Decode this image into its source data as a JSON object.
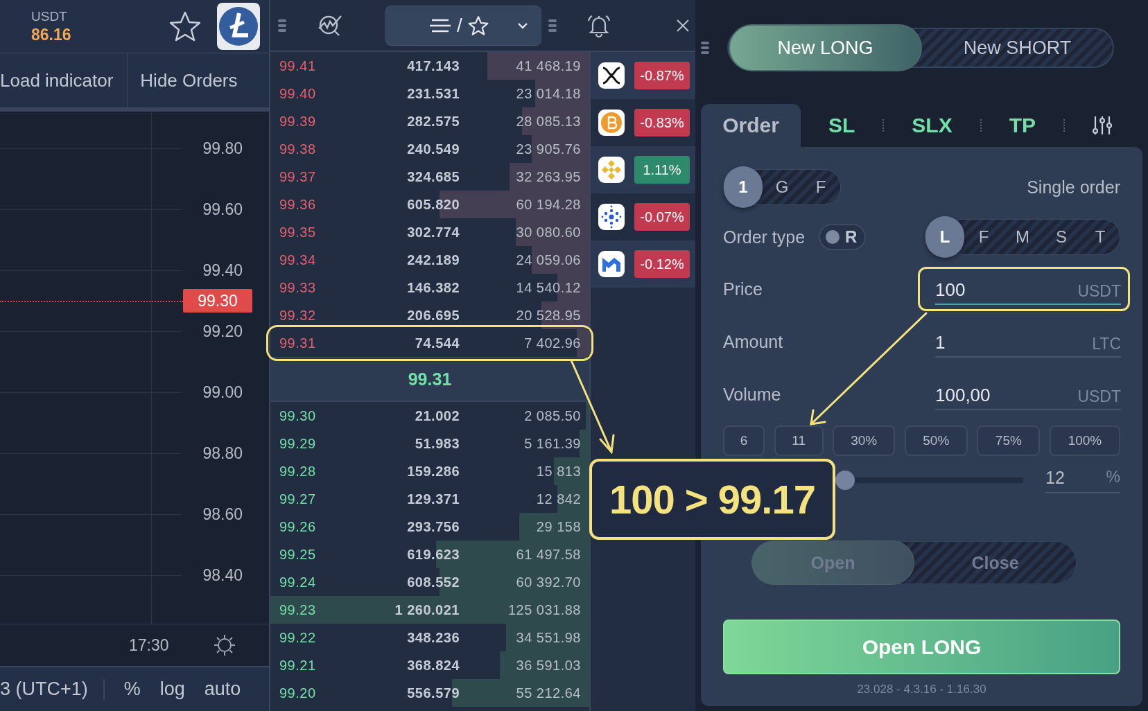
{
  "header": {
    "quote_label": "USDT",
    "price": "86.16"
  },
  "chart_toolbar": {
    "buttons": [
      "Load indicator",
      "Hide Orders"
    ]
  },
  "chart": {
    "price_axis": [
      "99.80",
      "99.60",
      "99.40",
      "99.20",
      "99.00",
      "98.80",
      "98.60",
      "98.40"
    ],
    "last_price": "99.30",
    "time_label": "17:30"
  },
  "chart_footer": {
    "timezone": "3 (UTC+1)",
    "options": [
      "%",
      "log",
      "auto"
    ]
  },
  "book_toolbar": {
    "filter_separator": "/"
  },
  "order_book": {
    "asks": [
      {
        "price": "99.41",
        "amount": "417.143",
        "total": "41 468.19",
        "level": 0.32,
        "highlighted": false
      },
      {
        "price": "99.40",
        "amount": "231.531",
        "total": "23 014.18",
        "level": 0.17,
        "highlighted": false
      },
      {
        "price": "99.39",
        "amount": "282.575",
        "total": "28 085.13",
        "level": 0.21,
        "highlighted": false
      },
      {
        "price": "99.38",
        "amount": "240.549",
        "total": "23 905.76",
        "level": 0.18,
        "highlighted": false
      },
      {
        "price": "99.37",
        "amount": "324.685",
        "total": "32 263.95",
        "level": 0.25,
        "highlighted": false
      },
      {
        "price": "99.36",
        "amount": "605.820",
        "total": "60 194.28",
        "level": 0.47,
        "highlighted": false
      },
      {
        "price": "99.35",
        "amount": "302.774",
        "total": "30 080.60",
        "level": 0.23,
        "highlighted": false
      },
      {
        "price": "99.34",
        "amount": "242.189",
        "total": "24 059.06",
        "level": 0.18,
        "highlighted": false
      },
      {
        "price": "99.33",
        "amount": "146.382",
        "total": "14 540.12",
        "level": 0.1,
        "highlighted": false
      },
      {
        "price": "99.32",
        "amount": "206.695",
        "total": "20 528.95",
        "level": 0.15,
        "highlighted": false
      },
      {
        "price": "99.31",
        "amount": "74.544",
        "total": "7 402.96",
        "level": 0.04,
        "highlighted": true
      }
    ],
    "mid_price": "99.31",
    "bids": [
      {
        "price": "99.30",
        "amount": "21.002",
        "total": "2 085.50",
        "level": 0.01
      },
      {
        "price": "99.29",
        "amount": "51.983",
        "total": "5 161.39",
        "level": 0.03
      },
      {
        "price": "99.28",
        "amount": "159.286",
        "total": "15 813",
        "level": 0.11
      },
      {
        "price": "99.27",
        "amount": "129.371",
        "total": "12 842",
        "level": 0.1
      },
      {
        "price": "99.26",
        "amount": "293.756",
        "total": "29 158",
        "level": 0.22
      },
      {
        "price": "99.25",
        "amount": "619.623",
        "total": "61 497.58",
        "level": 0.48
      },
      {
        "price": "99.24",
        "amount": "608.552",
        "total": "60 392.70",
        "level": 0.47
      },
      {
        "price": "99.23",
        "amount": "1 260.021",
        "total": "125 031.88",
        "level": 1
      },
      {
        "price": "99.22",
        "amount": "348.236",
        "total": "34 551.98",
        "level": 0.26
      },
      {
        "price": "99.21",
        "amount": "368.824",
        "total": "36 591.03",
        "level": 0.28
      },
      {
        "price": "99.20",
        "amount": "556.579",
        "total": "55 212.64",
        "level": 0.43
      }
    ]
  },
  "watchlist": [
    {
      "change": "-0.87%",
      "color": "#c23a50"
    },
    {
      "change": "-0.83%",
      "color": "#c23a50"
    },
    {
      "change": "1.11%",
      "color": "#2f8a6c"
    },
    {
      "change": "-0.07%",
      "color": "#c23a50"
    },
    {
      "change": "-0.12%",
      "color": "#c23a50"
    }
  ],
  "trade_panel": {
    "sides": [
      {
        "label": "New LONG",
        "selected": true
      },
      {
        "label": "New SHORT",
        "selected": false
      }
    ],
    "tabs": [
      {
        "label": "Order",
        "selected": true
      },
      {
        "label": "SL",
        "selected": false
      },
      {
        "label": "SLX",
        "selected": false
      },
      {
        "label": "TP",
        "selected": false
      }
    ],
    "modes": [
      {
        "label": "1",
        "selected": true
      },
      {
        "label": "G",
        "selected": false
      },
      {
        "label": "F",
        "selected": false
      }
    ],
    "mode_label": "Single order",
    "order_type": {
      "label": "Order type",
      "toggle_label": "R",
      "on": false,
      "options": [
        {
          "label": "L",
          "selected": true
        },
        {
          "label": "F",
          "selected": false
        },
        {
          "label": "M",
          "selected": false
        },
        {
          "label": "S",
          "selected": false
        },
        {
          "label": "T",
          "selected": false
        }
      ]
    },
    "fields": [
      {
        "label": "Price",
        "value": "100",
        "unit": "USDT",
        "focused": true,
        "highlighted": true
      },
      {
        "label": "Amount",
        "value": "1",
        "unit": "LTC",
        "focused": false,
        "highlighted": false
      },
      {
        "label": "Volume",
        "value": "100,00",
        "unit": "USDT",
        "focused": false,
        "highlighted": false
      }
    ],
    "presets": [
      "6",
      "11",
      "30%",
      "50%",
      "75%",
      "100%"
    ],
    "slider": {
      "level": 0,
      "value": "12",
      "unit": "%"
    },
    "actions": {
      "disabled": true,
      "items": [
        {
          "label": "Open",
          "selected": true
        },
        {
          "label": "Close",
          "selected": false
        }
      ]
    },
    "submit": "Open LONG",
    "version": "23.028 - 4.3.16 - 1.16.30"
  },
  "annotation": {
    "callout": "100 > 99.17"
  }
}
